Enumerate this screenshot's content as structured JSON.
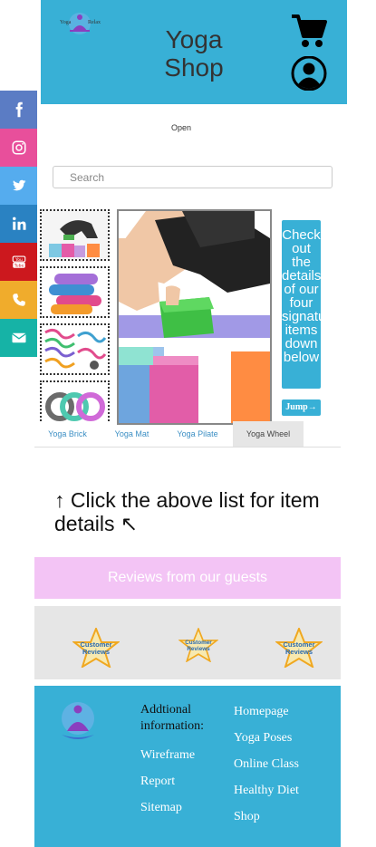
{
  "header": {
    "logo_text_left": "Yoga",
    "logo_text_right": "Relax",
    "title_line1": "Yoga",
    "title_line2": "Shop"
  },
  "social": [
    {
      "name": "facebook",
      "color": "#5b7cc4"
    },
    {
      "name": "instagram",
      "color": "#e84f9b"
    },
    {
      "name": "twitter",
      "color": "#55acee"
    },
    {
      "name": "linkedin",
      "color": "#2a82c2"
    },
    {
      "name": "youtube",
      "color": "#cc181e"
    },
    {
      "name": "phone",
      "color": "#f0ac2c"
    },
    {
      "name": "email",
      "color": "#16b3a6"
    }
  ],
  "nav": {
    "open_label": "Open"
  },
  "search": {
    "placeholder": "Search"
  },
  "promo": {
    "text": "Check out the details of our four signature items down below",
    "jump_label": "Jump→"
  },
  "tabs": [
    "Yoga Brick",
    "Yoga Mat",
    "Yoga Pilate",
    "Yoga Wheel"
  ],
  "instruction": "↑ Click the above list for item details ↖",
  "reviews": {
    "title": "Reviews from our guests",
    "badge_line1": "Customer",
    "badge_line2": "Reviews"
  },
  "footer": {
    "additional_label": "Addtional information:",
    "links_left": [
      "Wireframe",
      "Report",
      "Sitemap"
    ],
    "links_right": [
      "Homepage",
      "Yoga Poses",
      "Online Class",
      "Healthy Diet",
      "Shop"
    ]
  },
  "colors": {
    "header_bg": "#38b0d6",
    "reviews_banner": "#f3c4f5",
    "gray_panel": "#e6e6e6"
  }
}
